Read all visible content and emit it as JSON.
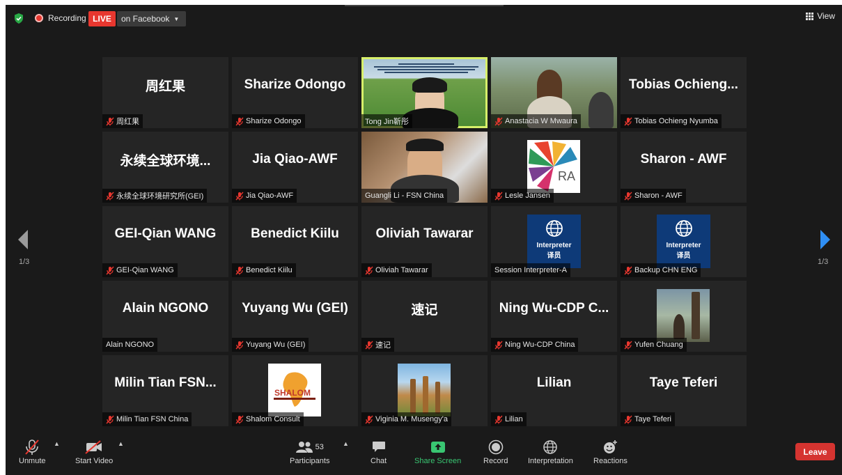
{
  "topbar": {
    "recording_label": "Recording",
    "live_badge": "LIVE",
    "live_destination": "on Facebook",
    "view_label": "View"
  },
  "gallery": {
    "page_indicator": "1/3",
    "tiles": [
      {
        "display": "周红果",
        "label": "周红果",
        "muted": true,
        "kind": "name"
      },
      {
        "display": "Sharize Odongo",
        "label": "Sharize Odongo",
        "muted": true,
        "kind": "name"
      },
      {
        "display": "",
        "label": "Tong Jin靳彤",
        "muted": false,
        "kind": "video",
        "speaking": true
      },
      {
        "display": "",
        "label": "Anastacia W Mwaura",
        "muted": true,
        "kind": "video"
      },
      {
        "display": "Tobias Ochieng...",
        "label": "Tobias Ochieng Nyumba",
        "muted": true,
        "kind": "name"
      },
      {
        "display": "永续全球环境...",
        "label": "永续全球环境研究所(GEI)",
        "muted": true,
        "kind": "name"
      },
      {
        "display": "Jia Qiao-AWF",
        "label": "Jia Qiao-AWF",
        "muted": true,
        "kind": "name"
      },
      {
        "display": "",
        "label": "Guangli Li - FSN China",
        "muted": false,
        "kind": "video"
      },
      {
        "display": "RA",
        "label": "Lesle Jansen",
        "muted": true,
        "kind": "logo"
      },
      {
        "display": "Sharon - AWF",
        "label": "Sharon - AWF",
        "muted": true,
        "kind": "name"
      },
      {
        "display": "GEI-Qian WANG",
        "label": "GEI-Qian WANG",
        "muted": true,
        "kind": "name"
      },
      {
        "display": "Benedict Kiilu",
        "label": "Benedict Kiilu",
        "muted": true,
        "kind": "name"
      },
      {
        "display": "Oliviah Tawarar",
        "label": "Oliviah Tawarar",
        "muted": true,
        "kind": "name"
      },
      {
        "display": "Interpreter",
        "display_sub": "译员",
        "label": "Session Interpreter-A",
        "muted": false,
        "kind": "interp"
      },
      {
        "display": "Interpreter",
        "display_sub": "译员",
        "label": "Backup CHN ENG",
        "muted": true,
        "kind": "interp"
      },
      {
        "display": "Alain NGONO",
        "label": "Alain NGONO",
        "muted": false,
        "kind": "name"
      },
      {
        "display": "Yuyang Wu (GEI)",
        "label": "Yuyang Wu (GEI)",
        "muted": true,
        "kind": "name"
      },
      {
        "display": "速记",
        "label": "速记",
        "muted": true,
        "kind": "name"
      },
      {
        "display": "Ning Wu-CDP C...",
        "label": "Ning Wu-CDP China",
        "muted": true,
        "kind": "name"
      },
      {
        "display": "",
        "label": "Yufen Chuang",
        "muted": true,
        "kind": "photo"
      },
      {
        "display": "Milin Tian FSN...",
        "label": "Milin Tian FSN China",
        "muted": true,
        "kind": "name"
      },
      {
        "display": "SHALOM",
        "label": "Shalom Consult",
        "muted": true,
        "kind": "shalom"
      },
      {
        "display": "",
        "label": "Viginia M. Musengy'a",
        "muted": true,
        "kind": "giraffe"
      },
      {
        "display": "Lilian",
        "label": "Lilian",
        "muted": true,
        "kind": "name"
      },
      {
        "display": "Taye Teferi",
        "label": "Taye Teferi",
        "muted": true,
        "kind": "name"
      }
    ]
  },
  "toolbar": {
    "unmute": "Unmute",
    "start_video": "Start Video",
    "participants": "Participants",
    "participants_count": "53",
    "chat": "Chat",
    "share_screen": "Share Screen",
    "record": "Record",
    "interpretation": "Interpretation",
    "reactions": "Reactions",
    "leave": "Leave",
    "share_color": "#39c672",
    "leave_color": "#d53430"
  }
}
